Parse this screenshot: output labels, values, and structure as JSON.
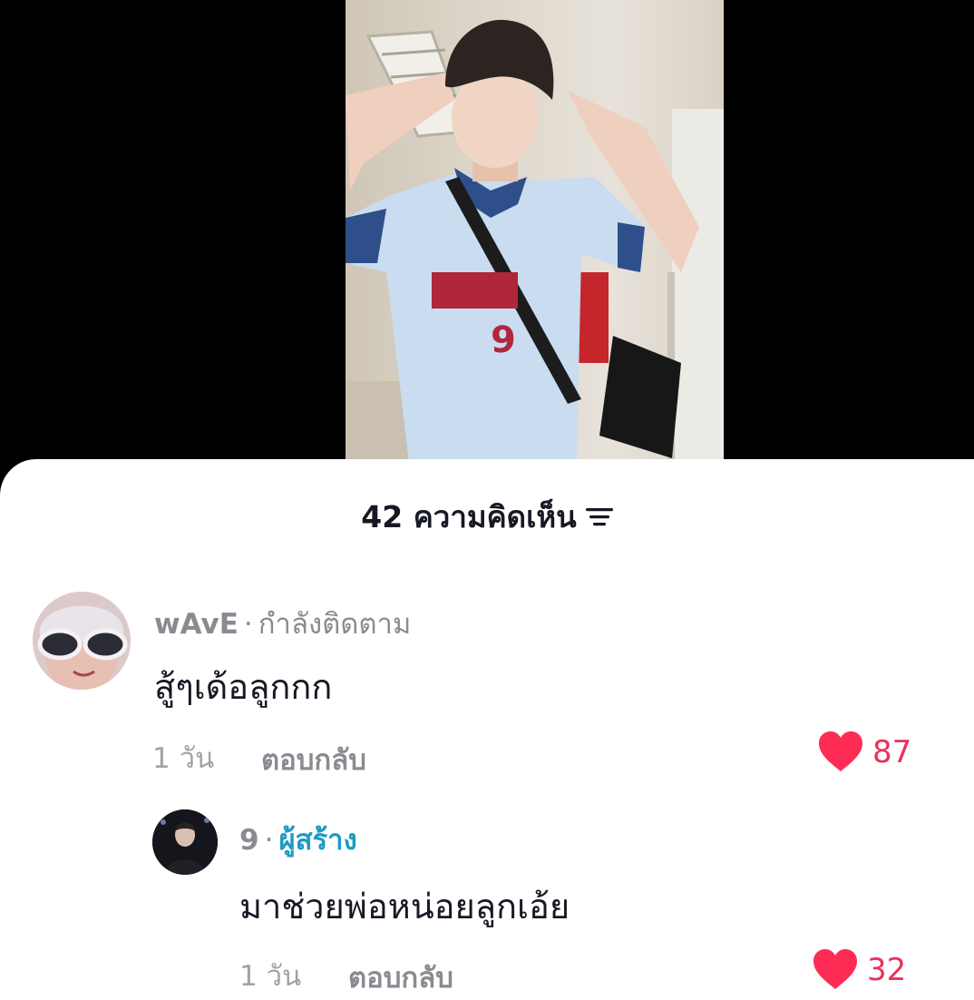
{
  "header": {
    "comment_count_label": "42 ความคิดเห็น"
  },
  "colors": {
    "like_red": "#fe2c55",
    "creator_blue": "#1d9bc2",
    "text_dark": "#161823",
    "text_gray": "#8a8b91"
  },
  "icons": {
    "sort": "sort-lines-icon",
    "like": "heart-icon"
  },
  "comments": [
    {
      "username": "wAvE",
      "separator": "·",
      "relation": "กำลังติดตาม",
      "text": "สู้ๆเด้อลูกกก",
      "time": "1 วัน",
      "reply_label": "ตอบกลับ",
      "likes": "87"
    },
    {
      "username": "9",
      "separator": "·",
      "relation": "ผู้สร้าง",
      "text": "มาช่วยพ่อหน่อยลูกเอ้ย",
      "time": "1 วัน",
      "reply_label": "ตอบกลับ",
      "likes": "32"
    }
  ]
}
